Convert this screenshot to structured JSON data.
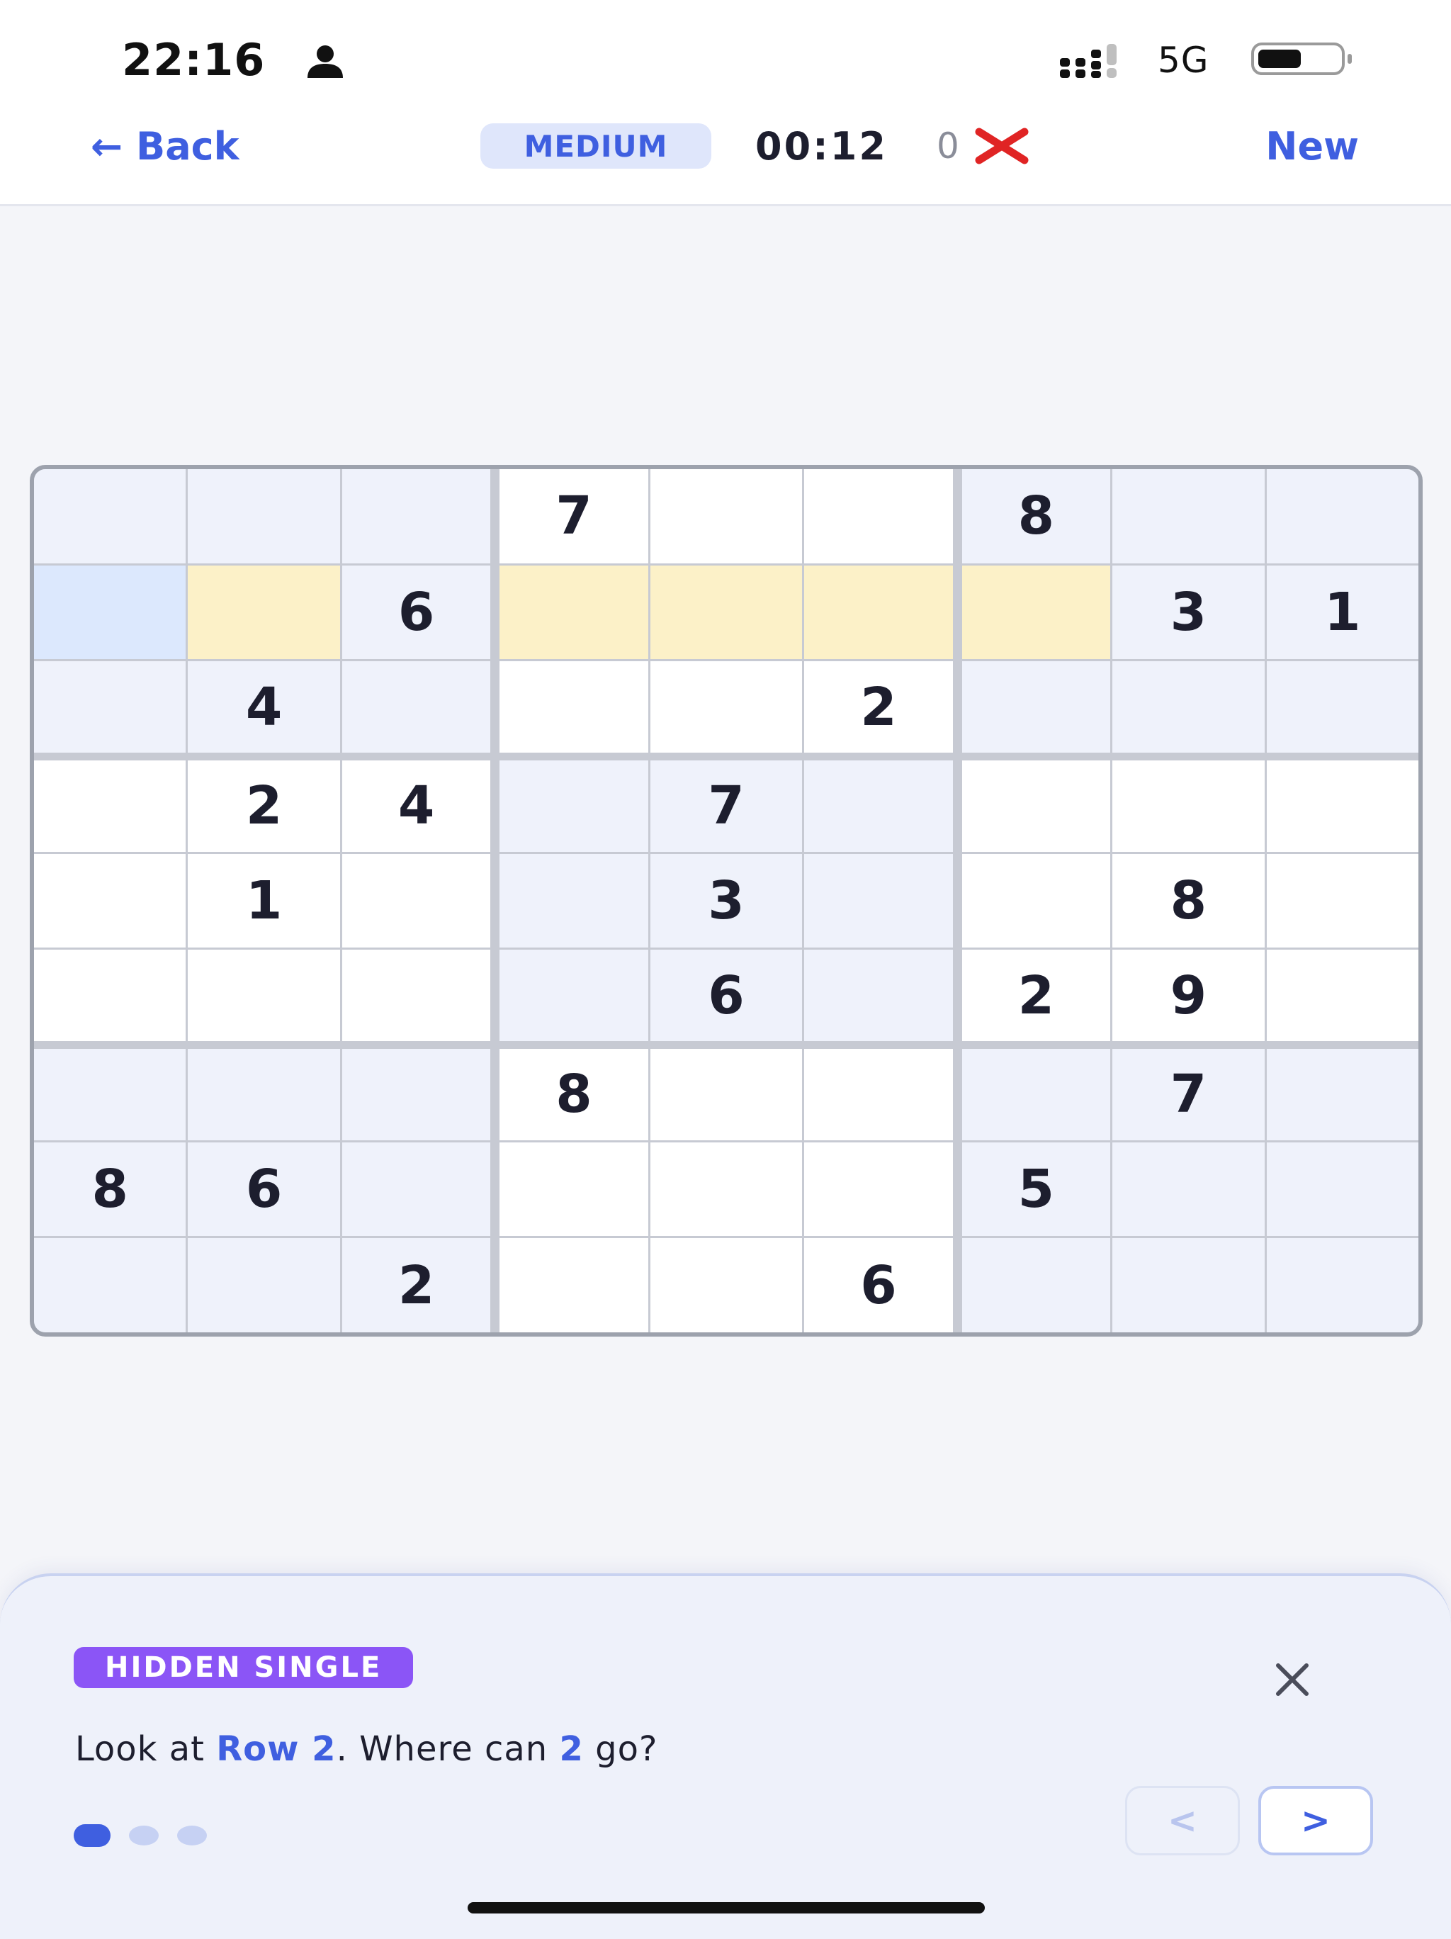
{
  "status_bar": {
    "time": "22:16",
    "network": "5G"
  },
  "header": {
    "back_label": "← Back",
    "difficulty": "MEDIUM",
    "timer": "00:12",
    "mistakes": "0",
    "new_label": "New"
  },
  "board": {
    "rows": [
      [
        "",
        "",
        "",
        "7",
        "",
        "",
        "8",
        "",
        ""
      ],
      [
        "",
        "",
        "6",
        "",
        "",
        "",
        "",
        "3",
        "1"
      ],
      [
        "",
        "4",
        "",
        "",
        "",
        "2",
        "",
        "",
        ""
      ],
      [
        "",
        "2",
        "4",
        "",
        "7",
        "",
        "",
        "",
        ""
      ],
      [
        "",
        "1",
        "",
        "",
        "3",
        "",
        "",
        "8",
        ""
      ],
      [
        "",
        "",
        "",
        "",
        "6",
        "",
        "2",
        "9",
        ""
      ],
      [
        "",
        "",
        "",
        "8",
        "",
        "",
        "",
        "7",
        ""
      ],
      [
        "8",
        "6",
        "",
        "",
        "",
        "",
        "5",
        "",
        ""
      ],
      [
        "",
        "",
        "2",
        "",
        "",
        "6",
        "",
        "",
        ""
      ]
    ],
    "selected_cell": [
      1,
      0
    ],
    "candidate_cells": [
      [
        1,
        1
      ],
      [
        1,
        3
      ],
      [
        1,
        4
      ],
      [
        1,
        5
      ],
      [
        1,
        6
      ]
    ],
    "colors": {
      "shaded": "#eff2fb",
      "candidate": "#fcf1c8",
      "selected": "#dce8fd"
    }
  },
  "hint": {
    "tag": "HIDDEN SINGLE",
    "text_prefix": "Look at ",
    "text_row": "Row 2",
    "text_mid": ". Where can ",
    "text_digit": "2",
    "text_suffix": " go?",
    "steps": 3,
    "current_step": 1,
    "prev_label": "<",
    "next_label": ">"
  },
  "colors": {
    "accent": "#3f5fe0",
    "tag": "#8b55f6",
    "mistake": "#e02424"
  }
}
